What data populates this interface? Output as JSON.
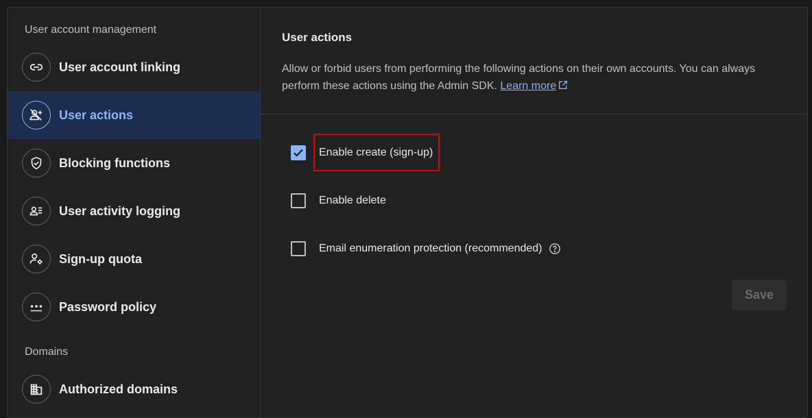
{
  "sidebar": {
    "section_user": "User account management",
    "section_domains": "Domains",
    "items": [
      {
        "label": "User account linking",
        "icon": "link-icon"
      },
      {
        "label": "User actions",
        "icon": "person-add-disabled-icon",
        "active": true
      },
      {
        "label": "Blocking functions",
        "icon": "shield-check-icon"
      },
      {
        "label": "User activity logging",
        "icon": "person-list-icon"
      },
      {
        "label": "Sign-up quota",
        "icon": "person-settings-icon"
      },
      {
        "label": "Password policy",
        "icon": "password-icon"
      },
      {
        "label": "Authorized domains",
        "icon": "domain-icon"
      }
    ]
  },
  "main": {
    "title": "User actions",
    "description": "Allow or forbid users from performing the following actions on their own accounts. You can always perform these actions using the Admin SDK.",
    "learn_more": "Learn more",
    "options": [
      {
        "label": "Enable create (sign-up)",
        "checked": true
      },
      {
        "label": "Enable delete",
        "checked": false
      },
      {
        "label": "Email enumeration protection (recommended)",
        "checked": false
      }
    ],
    "save_label": "Save"
  },
  "colors": {
    "accent": "#8ab4f8",
    "active_bg": "#1c2d4d",
    "highlight": "#e00000"
  }
}
